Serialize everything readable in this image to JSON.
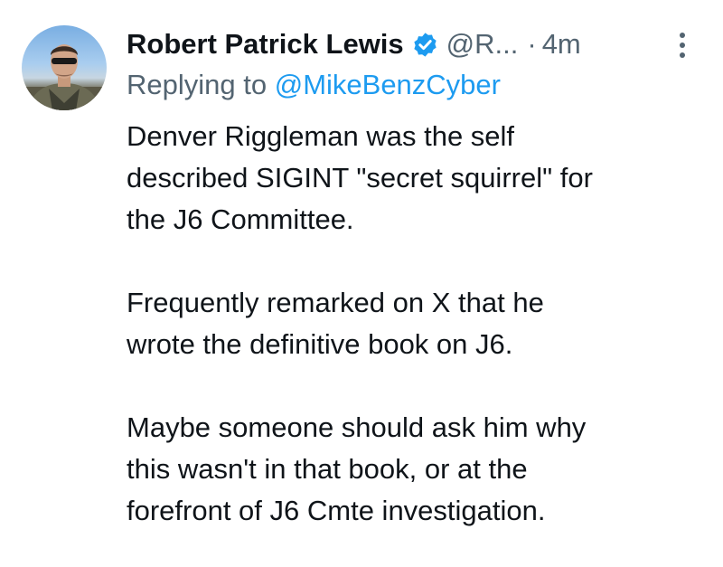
{
  "tweet": {
    "author": {
      "display_name": "Robert Patrick Lewis",
      "handle": "@R...",
      "verified": true,
      "verified_color": "#1d9bf0"
    },
    "separator": "·",
    "timestamp": "4m",
    "reply": {
      "prefix": "Replying to ",
      "mention": "@MikeBenzCyber"
    },
    "body": {
      "paragraphs": [
        [
          "Denver Riggleman was the self",
          "described SIGINT \"secret squirrel\" for",
          "the J6 Committee."
        ],
        [
          "Frequently remarked on X that he",
          "wrote the definitive book on J6."
        ],
        [
          "Maybe someone should ask him why",
          "this wasn't in that book, or at the",
          "forefront of J6 Cmte investigation."
        ]
      ]
    },
    "icons": {
      "more": "more-vertical-icon",
      "verified": "verified-badge-icon"
    }
  }
}
